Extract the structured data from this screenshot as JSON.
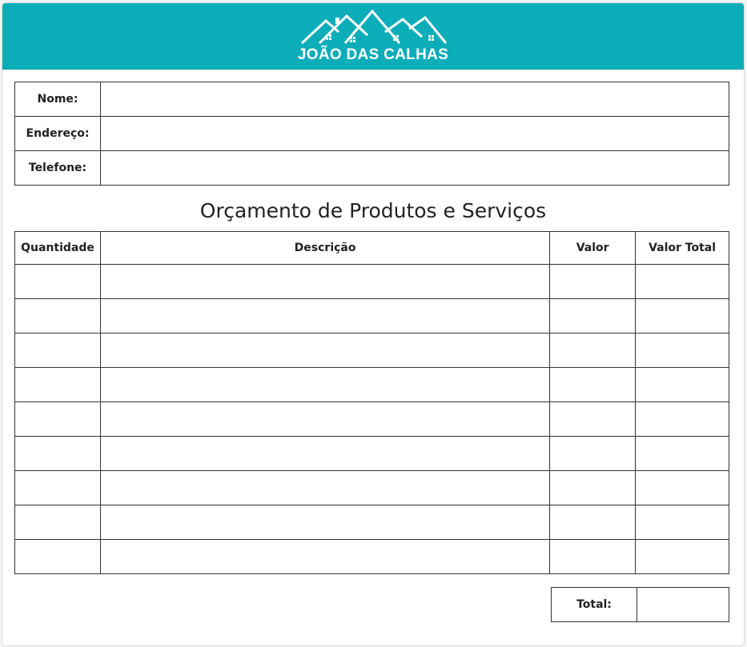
{
  "brand": {
    "name": "JOÃO DAS CALHAS",
    "accent": "#0badb9",
    "logo_icon": "house-roofs-icon"
  },
  "client_fields": [
    {
      "label": "Nome:",
      "value": ""
    },
    {
      "label": "Endereço:",
      "value": ""
    },
    {
      "label": "Telefone:",
      "value": ""
    }
  ],
  "section_title": "Orçamento de Produtos e Serviços",
  "items_table": {
    "columns": [
      "Quantidade",
      "Descrição",
      "Valor",
      "Valor Total"
    ],
    "rows": [
      [
        "",
        "",
        "",
        ""
      ],
      [
        "",
        "",
        "",
        ""
      ],
      [
        "",
        "",
        "",
        ""
      ],
      [
        "",
        "",
        "",
        ""
      ],
      [
        "",
        "",
        "",
        ""
      ],
      [
        "",
        "",
        "",
        ""
      ],
      [
        "",
        "",
        "",
        ""
      ],
      [
        "",
        "",
        "",
        ""
      ],
      [
        "",
        "",
        "",
        ""
      ]
    ]
  },
  "total": {
    "label": "Total:",
    "value": ""
  }
}
